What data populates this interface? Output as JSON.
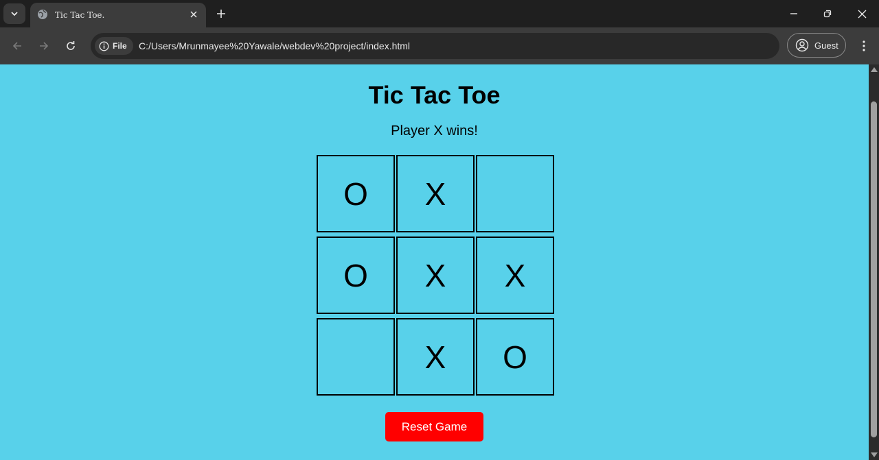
{
  "browser": {
    "tab_title": "Tic Tac Toe.",
    "address_chip": "File",
    "url": "C:/Users/Mrunmayee%20Yawale/webdev%20project/index.html",
    "profile_label": "Guest"
  },
  "page": {
    "title": "Tic Tac Toe",
    "status": "Player X wins!",
    "board": [
      "O",
      "X",
      "",
      "O",
      "X",
      "X",
      "",
      "X",
      "O"
    ],
    "reset_label": "Reset Game",
    "background_color": "#58d1ea",
    "reset_color": "#ff0000"
  }
}
